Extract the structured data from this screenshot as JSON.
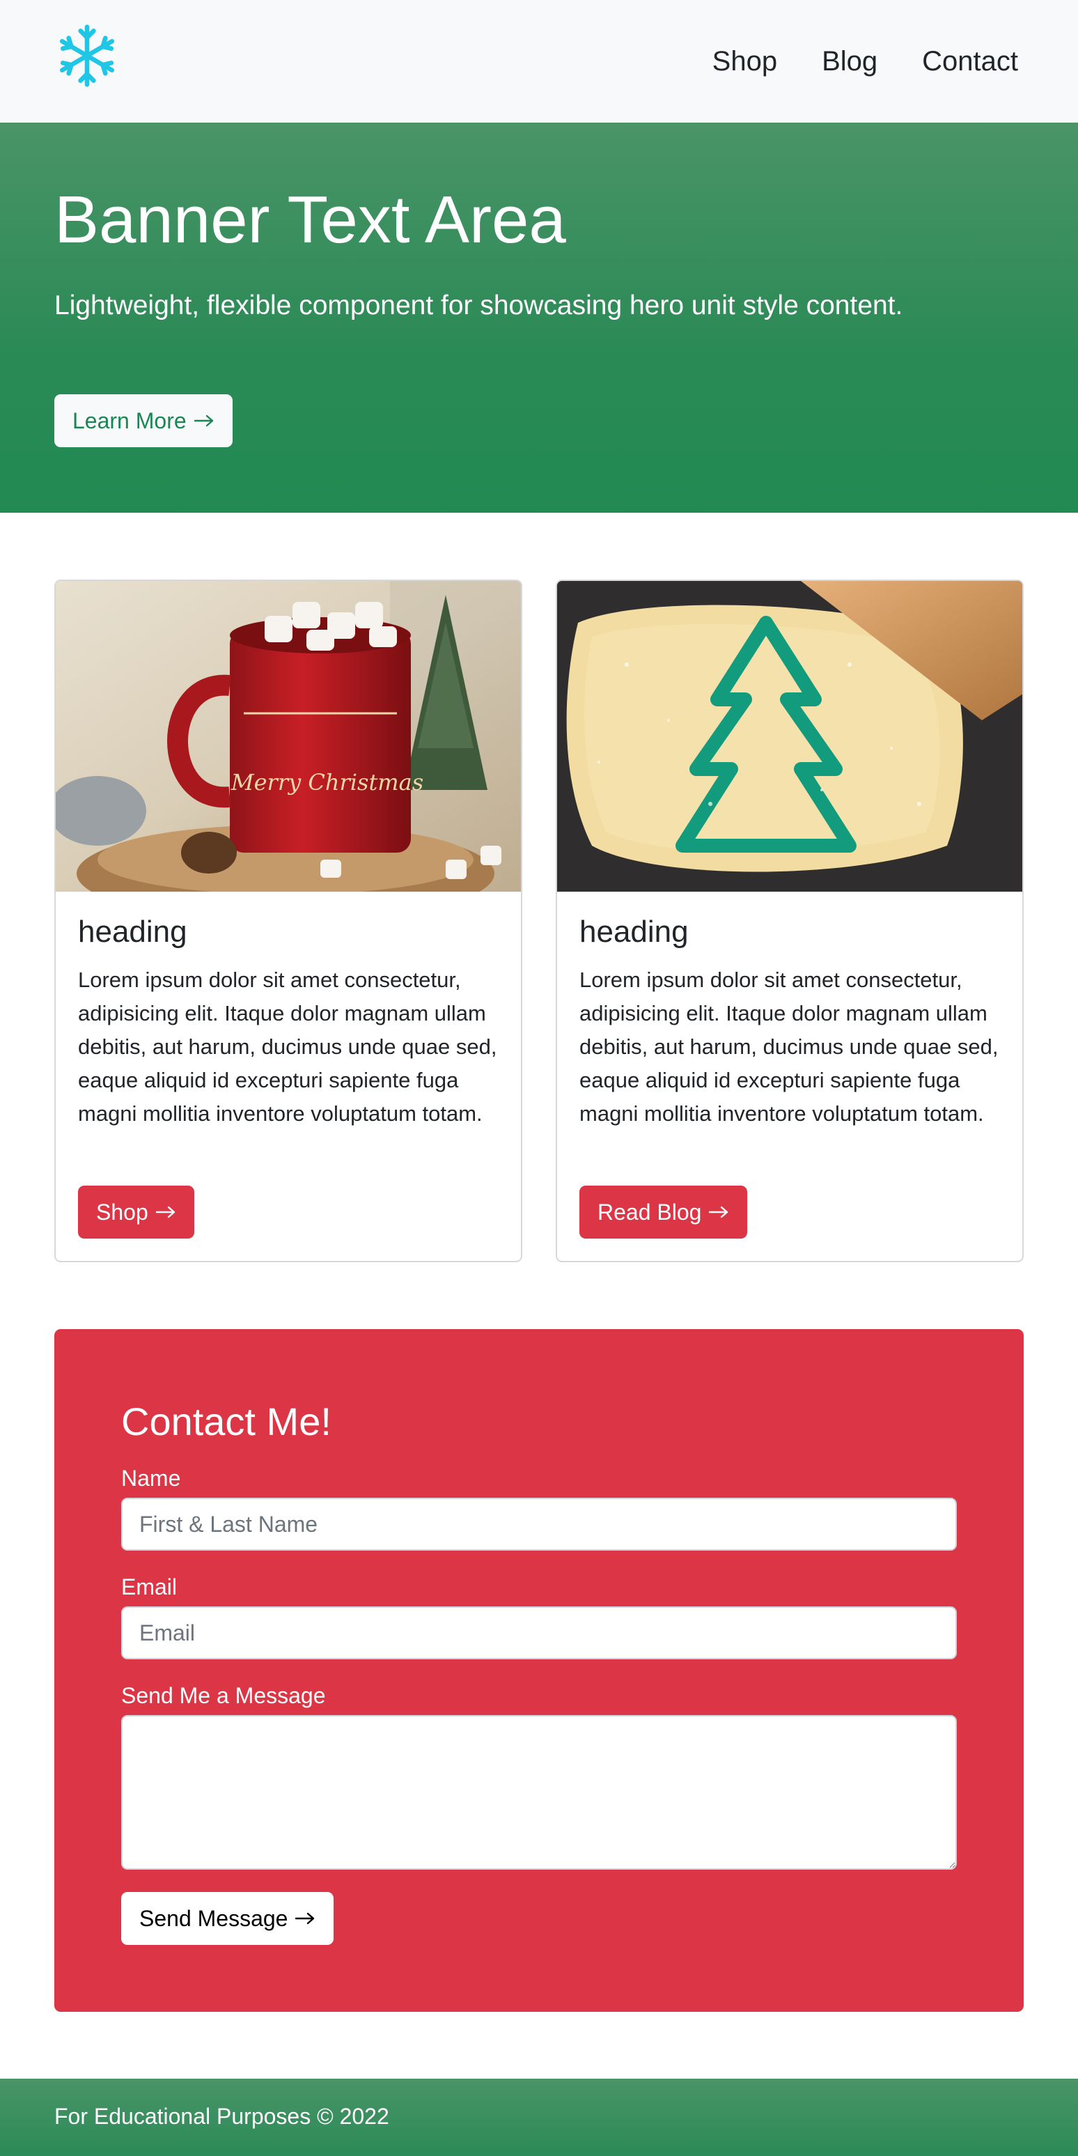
{
  "nav": {
    "logo_icon": "snowflake-icon",
    "logo_color": "#1fc6e6",
    "links": [
      "Shop",
      "Blog",
      "Contact"
    ]
  },
  "hero": {
    "title": "Banner Text Area",
    "subtitle": "Lightweight, flexible component for showcasing hero unit style content.",
    "button_label": "Learn More",
    "button_icon": "arrow-right-icon",
    "color": "#198754"
  },
  "cards": [
    {
      "image": "hot-cocoa-mug-photo",
      "title": "heading",
      "text": "Lorem ipsum dolor sit amet consectetur, adipisicing elit. Itaque dolor magnam ullam debitis, aut harum, ducimus unde quae sed, eaque aliquid id excepturi sapiente fuga magni mollitia inventore voluptatum totam.",
      "button_label": "Shop",
      "image_text": "Merry Christmas"
    },
    {
      "image": "tree-cookie-cutter-photo",
      "title": "heading",
      "text": "Lorem ipsum dolor sit amet consectetur, adipisicing elit. Itaque dolor magnam ullam debitis, aut harum, ducimus unde quae sed, eaque aliquid id excepturi sapiente fuga magni mollitia inventore voluptatum totam.",
      "button_label": "Read Blog"
    }
  ],
  "contact": {
    "title": "Contact Me!",
    "name_label": "Name",
    "name_placeholder": "First & Last Name",
    "email_label": "Email",
    "email_placeholder": "Email",
    "message_label": "Send Me a Message",
    "message_value": "",
    "button_label": "Send Message",
    "color": "#dc3545"
  },
  "footer": {
    "text": "For Educational Purposes © 2022"
  }
}
